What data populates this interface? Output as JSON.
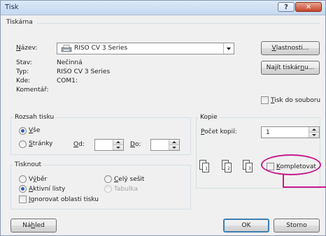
{
  "window": {
    "title": "Tisk",
    "help_label": "?",
    "close_label": "✕"
  },
  "printer_section": {
    "header": "Tiskárna",
    "name_label": "Název:",
    "name_value": "RISO CV 3 Series",
    "status_label": "Stav:",
    "status_value": "Nečinná",
    "type_label": "Typ:",
    "type_value": "RISO CV 3 Series",
    "where_label": "Kde:",
    "where_value": "COM1:",
    "comment_label": "Komentář:",
    "properties_button": "Vlastnosti...",
    "find_printer_button": "Najít tiskárnu...",
    "print_to_file_label": "Tisk do souboru"
  },
  "print_range": {
    "header": "Rozsah tisku",
    "all_label": "Vše",
    "pages_label": "Stránky",
    "from_label": "Od:",
    "to_label": "Do:"
  },
  "copies": {
    "header": "Kopie",
    "count_label": "Počet kopií:",
    "count_value": "1",
    "collate_label": "Kompletovat",
    "page_labels": [
      "1",
      "2",
      "3"
    ]
  },
  "print_what": {
    "header": "Tisknout",
    "selection_label": "Výběr",
    "entire_workbook_label": "Celý sešit",
    "active_sheets_label": "Aktivní listy",
    "table_label": "Tabulka",
    "ignore_print_areas_label": "Ignorovat oblasti tisku"
  },
  "footer": {
    "preview_button": "Náhled",
    "ok_button": "OK",
    "cancel_button": "Storno"
  },
  "colors": {
    "callout": "#c61a8d",
    "radio_selected": "#2a62b8"
  }
}
